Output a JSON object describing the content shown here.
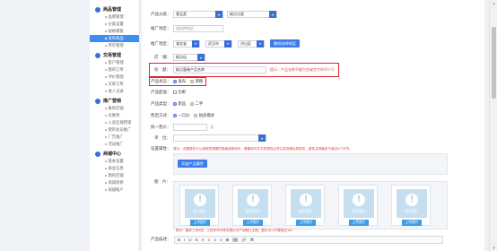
{
  "sidebar": {
    "groups": [
      {
        "title": "商品管理",
        "items": [
          "品牌管理",
          "分类设置",
          "规格模板",
          "发布商品",
          "库存管理"
        ],
        "active_index": 3
      },
      {
        "title": "交易管理",
        "items": [
          "客户管理",
          "我的订单",
          "评价管理",
          "买家订单",
          "收入记录"
        ]
      },
      {
        "title": "推广营销",
        "items": [
          "推荐店铺",
          "优惠券",
          "入驻区域营销",
          "我的会员推广",
          "广告推广",
          "活动推广"
        ]
      },
      {
        "title": "商铺中心",
        "items": [
          "基本设置",
          "商业信息",
          "我的店铺",
          "商铺装修",
          "商铺账户"
        ]
      }
    ]
  },
  "form": {
    "category": {
      "label": "产品分类：",
      "value1": "食品类",
      "value2": "糕点点类"
    },
    "area": {
      "label": "推广地区：",
      "placeholder": "请选择地区"
    },
    "region": {
      "label": "推广地区：",
      "v1": "湖北省",
      "v2": "武汉市",
      "v3": "洪山区",
      "button": "删除选择地区"
    },
    "shop": {
      "label": "店　铺：",
      "value": "糕点店"
    },
    "title": {
      "label": "标　题：",
      "value": "糕点蛋卷产品名称",
      "hint": "提示：产品名称不能为空或空字符不少于"
    },
    "status": {
      "label": "产品状态：",
      "opt1": "发布",
      "opt2": "草稿"
    },
    "shipping": {
      "label": "产品配送：",
      "opt1": "包邮"
    },
    "type": {
      "label": "产品类型：",
      "opt1": "新品",
      "opt2": "二手"
    },
    "guarantee": {
      "label": "售后方式：",
      "opt1": "一口价",
      "opt2": "拍卖模式"
    },
    "price": {
      "label": "统一售价：",
      "unit": "元"
    },
    "units": {
      "label": "单　位：",
      "hint": "提示：无需填写不定位单位或者增加价格信息，需注意单位不能单项仅可以填写最多不超过4个字符"
    },
    "attrs": {
      "label": "设置属性：",
      "hint": "提示：设置属性可以按照您想要的规格参数填写，需要填写文字的属性必须认真查看后再发布，属性名称最多不超过6个字符。",
      "button": "添加产品属性"
    },
    "images": {
      "label": "图　片：",
      "placeholder": "暂无图片",
      "upload": "上传图片",
      "hint": "提示：最多上传5张，上传完毕可单击图片为产品默认主图，图片大小不要超过1M。"
    },
    "detail": {
      "label": "产品描述："
    }
  },
  "toolbar": [
    "B",
    "I",
    "U",
    "S",
    "A",
    "≡",
    "≡",
    "≡",
    "⊞",
    "🖼",
    "🔗",
    "⌘"
  ]
}
